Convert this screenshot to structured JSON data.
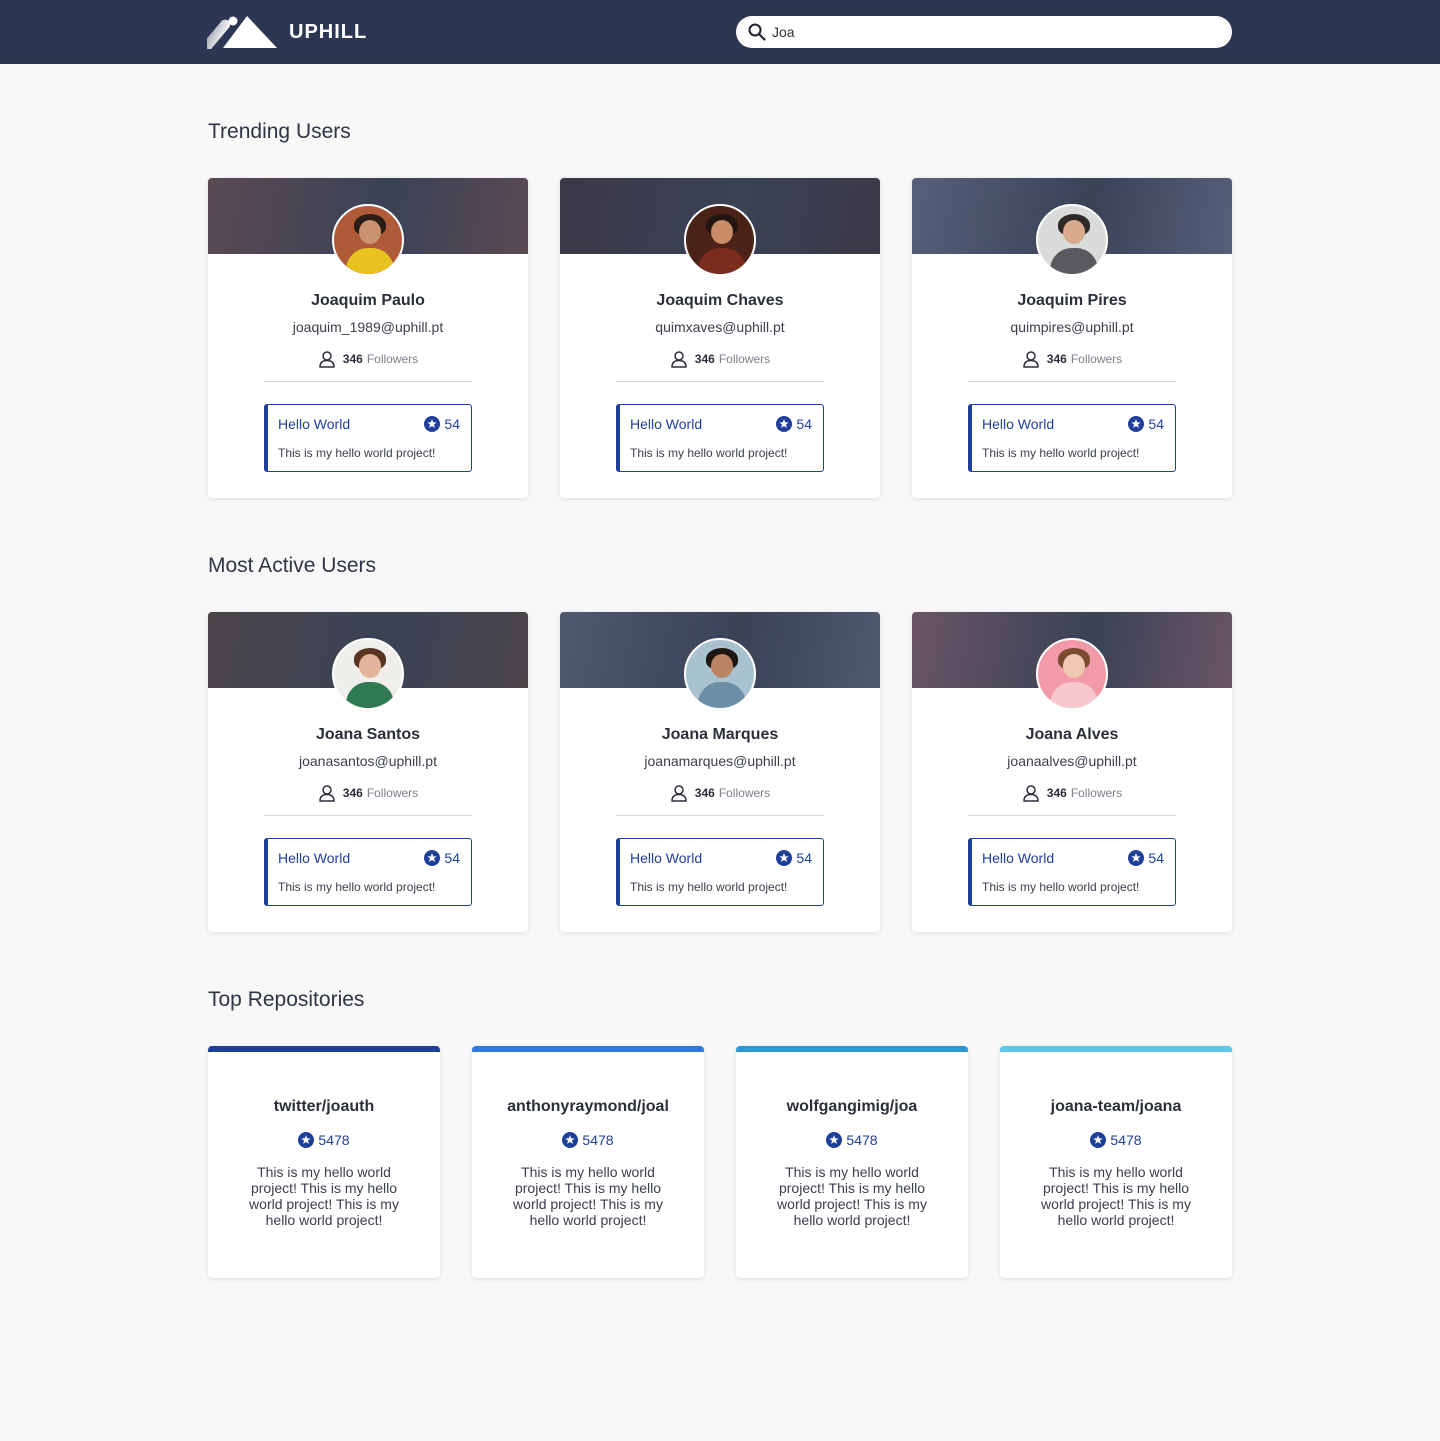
{
  "header": {
    "brand": "UPHILL",
    "search_value": "Joa"
  },
  "sections": {
    "trending_title": "Trending Users",
    "active_title": "Most Active Users",
    "repos_title": "Top Repositories"
  },
  "trending_users": [
    {
      "name": "Joaquim Paulo",
      "email": "joaquim_1989@uphill.pt",
      "followers_count": "346",
      "followers_label": "Followers",
      "project_name": "Hello World",
      "project_stars": "54",
      "project_desc": "This is my hello world project!",
      "cover_color": "#5a4a52",
      "avatar_bg": "#b05a3a",
      "skin": "#c9936f",
      "hair": "#2a1d16",
      "shirt": "#e8c21e"
    },
    {
      "name": "Joaquim Chaves",
      "email": "quimxaves@uphill.pt",
      "followers_count": "346",
      "followers_label": "Followers",
      "project_name": "Hello World",
      "project_stars": "54",
      "project_desc": "This is my hello world project!",
      "cover_color": "#3b3846",
      "avatar_bg": "#4a2218",
      "skin": "#c98c66",
      "hair": "#231510",
      "shirt": "#7b2c1c"
    },
    {
      "name": "Joaquim Pires",
      "email": "quimpires@uphill.pt",
      "followers_count": "346",
      "followers_label": "Followers",
      "project_name": "Hello World",
      "project_stars": "54",
      "project_desc": "This is my hello world project!",
      "cover_color": "#56607a",
      "avatar_bg": "#d9dcd8",
      "skin": "#d8ab8c",
      "hair": "#2e2a28",
      "shirt": "#5a5a5e"
    }
  ],
  "active_users": [
    {
      "name": "Joana Santos",
      "email": "joanasantos@uphill.pt",
      "followers_count": "346",
      "followers_label": "Followers",
      "project_name": "Hello World",
      "project_stars": "54",
      "project_desc": "This is my hello world project!",
      "cover_color": "#4a4448",
      "avatar_bg": "#efeeea",
      "skin": "#e3b49a",
      "hair": "#5a3422",
      "shirt": "#2f7a52"
    },
    {
      "name": "Joana Marques",
      "email": "joanamarques@uphill.pt",
      "followers_count": "346",
      "followers_label": "Followers",
      "project_name": "Hello World",
      "project_stars": "54",
      "project_desc": "This is my hello world project!",
      "cover_color": "#4d5a70",
      "avatar_bg": "#a9c2cf",
      "skin": "#b98566",
      "hair": "#1e1612",
      "shirt": "#6a8fa6"
    },
    {
      "name": "Joana Alves",
      "email": "joanaalves@uphill.pt",
      "followers_count": "346",
      "followers_label": "Followers",
      "project_name": "Hello World",
      "project_stars": "54",
      "project_desc": "This is my hello world project!",
      "cover_color": "#6a5566",
      "avatar_bg": "#f29aa8",
      "skin": "#f1c9b3",
      "hair": "#7a4b2e",
      "shirt": "#f6c7cc"
    }
  ],
  "repos": [
    {
      "name": "twitter/joauth",
      "stars": "5478",
      "desc": "This is my hello world project! This is my hello world project! This is my hello world project!",
      "accent": "#1f3f9b"
    },
    {
      "name": "anthonyraymond/joal",
      "stars": "5478",
      "desc": "This is my hello world project! This is my hello world project! This is my hello world project!",
      "accent": "#2d7be0"
    },
    {
      "name": "wolfgangimig/joa",
      "stars": "5478",
      "desc": "This is my hello world project! This is my hello world project! This is my hello world project!",
      "accent": "#2a9ad6"
    },
    {
      "name": "joana-team/joana",
      "stars": "5478",
      "desc": "This is my hello world project! This is my hello world project! This is my hello world project!",
      "accent": "#5bc8ea"
    }
  ],
  "icons": {
    "logo": "mountain-logo-icon",
    "search": "search-icon",
    "followers": "person-icon",
    "star": "star-badge-icon"
  }
}
